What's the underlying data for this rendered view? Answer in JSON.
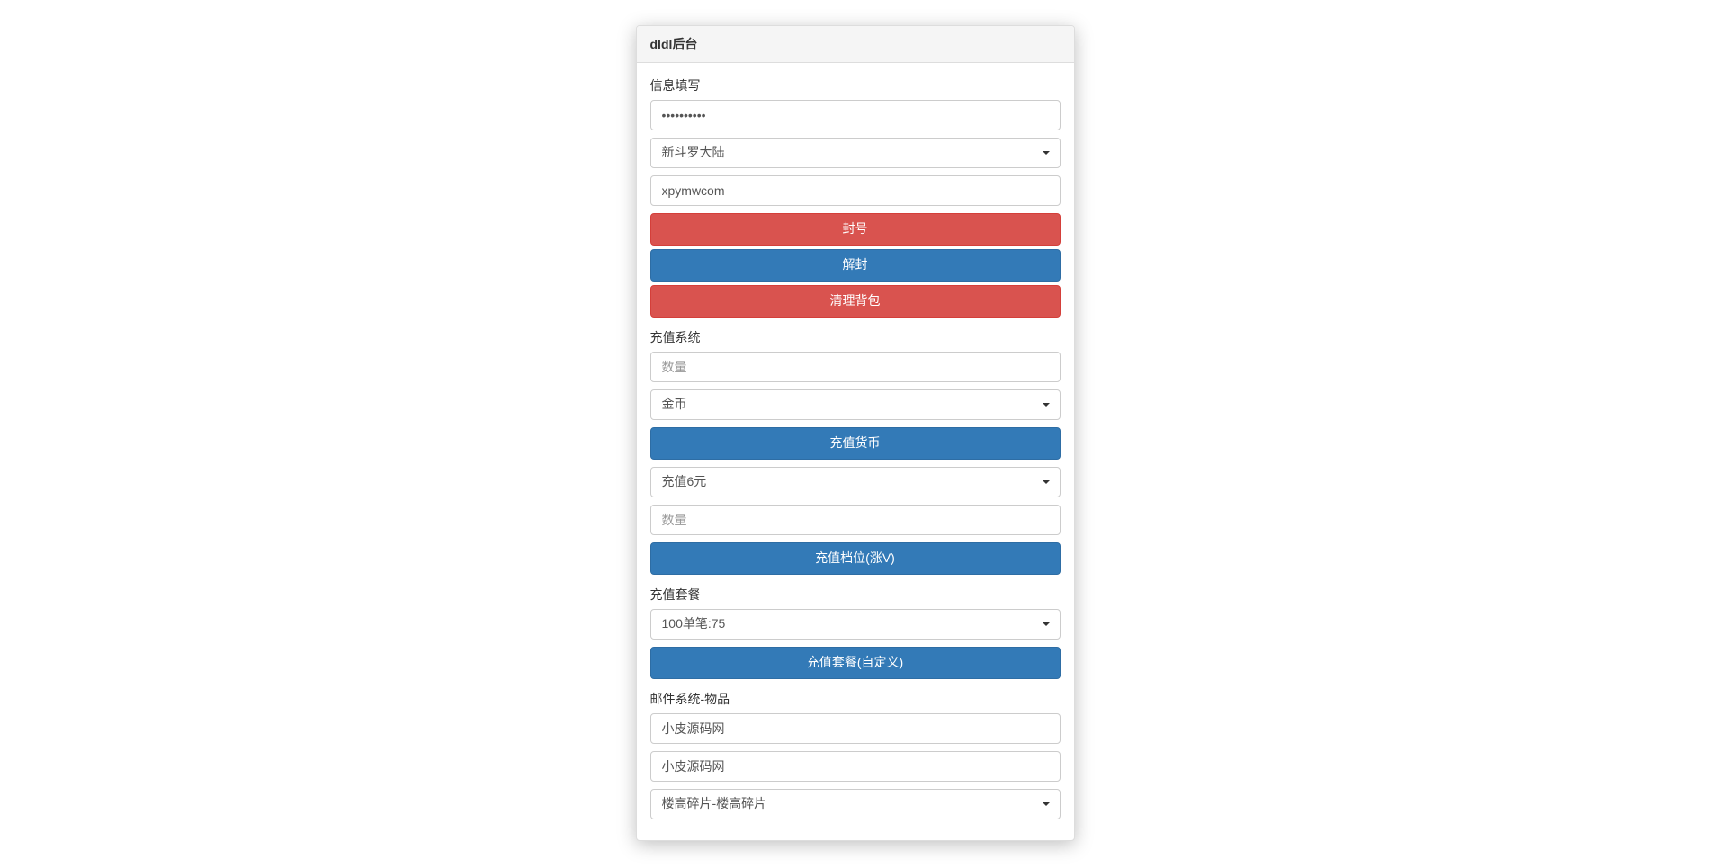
{
  "panel_title": "dldl后台",
  "info": {
    "section_label": "信息填写",
    "password_value": "••••••••••",
    "server_select": "新斗罗大陆",
    "account_value": "xpymwcom"
  },
  "actions": {
    "ban_label": "封号",
    "unban_label": "解封",
    "clear_bag_label": "清理背包"
  },
  "recharge": {
    "section_label": "充值系统",
    "quantity_placeholder": "数量",
    "currency_select": "金币",
    "charge_currency_label": "充值货币",
    "tier_select": "充值6元",
    "tier_quantity_placeholder": "数量",
    "charge_tier_label": "充值档位(涨V)"
  },
  "package": {
    "section_label": "充值套餐",
    "package_select": "100单笔:75",
    "charge_package_label": "充值套餐(自定义)"
  },
  "mail": {
    "section_label": "邮件系统-物品",
    "field1_value": "小皮源码网",
    "field2_value": "小皮源码网",
    "item_select": "楼高碎片-楼高碎片"
  }
}
